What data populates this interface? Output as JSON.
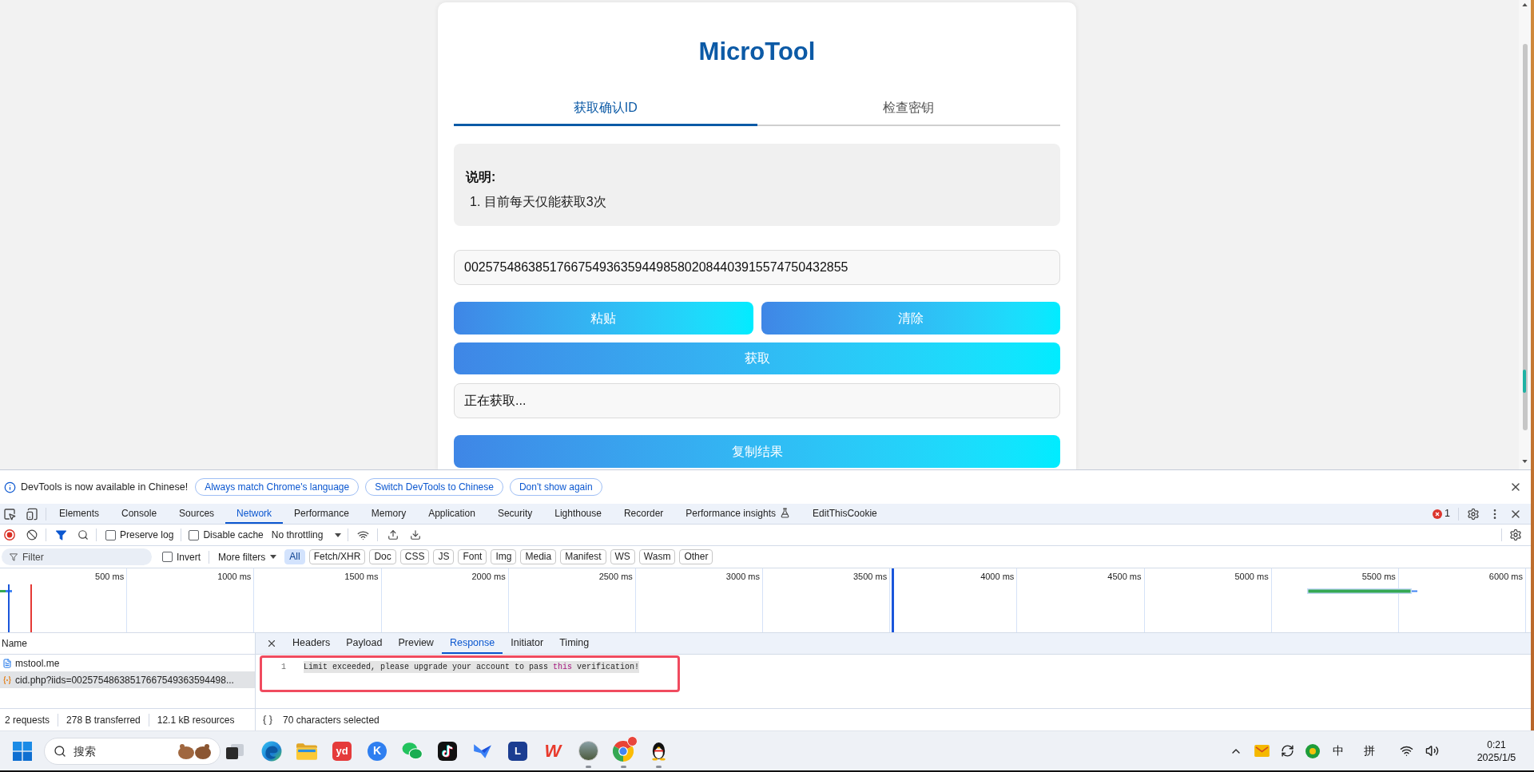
{
  "page": {
    "title": "MicroTool",
    "tabs": [
      {
        "label": "获取确认ID",
        "selected": true
      },
      {
        "label": "检查密钥",
        "selected": false
      }
    ],
    "notice": {
      "heading": "说明:",
      "items": [
        "1. 目前每天仅能获取3次"
      ]
    },
    "id_input": {
      "value": "002575486385176675493635944985802084403915574750432855"
    },
    "button_row": [
      {
        "label": "粘贴"
      },
      {
        "label": "清除"
      }
    ],
    "fetch_button": {
      "label": "获取"
    },
    "result": {
      "value": "正在获取..."
    },
    "copy_button": {
      "label": "复制结果"
    }
  },
  "devtools": {
    "infobar": {
      "message": "DevTools is now available in Chinese!",
      "buttons": [
        "Always match Chrome's language",
        "Switch DevTools to Chinese",
        "Don't show again"
      ]
    },
    "tabs": [
      {
        "label": "Elements",
        "selected": false,
        "experimental": false
      },
      {
        "label": "Console",
        "selected": false,
        "experimental": false
      },
      {
        "label": "Sources",
        "selected": false,
        "experimental": false
      },
      {
        "label": "Network",
        "selected": true,
        "experimental": false
      },
      {
        "label": "Performance",
        "selected": false,
        "experimental": false
      },
      {
        "label": "Memory",
        "selected": false,
        "experimental": false
      },
      {
        "label": "Application",
        "selected": false,
        "experimental": false
      },
      {
        "label": "Security",
        "selected": false,
        "experimental": false
      },
      {
        "label": "Lighthouse",
        "selected": false,
        "experimental": false
      },
      {
        "label": "Recorder",
        "selected": false,
        "experimental": false
      },
      {
        "label": "Performance insights",
        "selected": false,
        "experimental": true
      },
      {
        "label": "EditThisCookie",
        "selected": false,
        "experimental": false
      }
    ],
    "error_count": "1",
    "toolbar": {
      "recording": true,
      "preserve_log": {
        "label": "Preserve log",
        "checked": false
      },
      "disable_cache": {
        "label": "Disable cache",
        "checked": false
      },
      "throttling": "No throttling"
    },
    "filter": {
      "placeholder": "Filter",
      "invert": {
        "label": "Invert",
        "checked": false
      },
      "more_filters": "More filters",
      "types": [
        {
          "label": "All",
          "selected": true
        },
        {
          "label": "Fetch/XHR",
          "selected": false
        },
        {
          "label": "Doc",
          "selected": false
        },
        {
          "label": "CSS",
          "selected": false
        },
        {
          "label": "JS",
          "selected": false
        },
        {
          "label": "Font",
          "selected": false
        },
        {
          "label": "Img",
          "selected": false
        },
        {
          "label": "Media",
          "selected": false
        },
        {
          "label": "Manifest",
          "selected": false
        },
        {
          "label": "WS",
          "selected": false
        },
        {
          "label": "Wasm",
          "selected": false
        },
        {
          "label": "Other",
          "selected": false
        }
      ]
    },
    "timeline": {
      "ticks": [
        "500 ms",
        "1000 ms",
        "1500 ms",
        "2000 ms",
        "2500 ms",
        "3000 ms",
        "3500 ms",
        "4000 ms",
        "4500 ms",
        "5000 ms",
        "5500 ms",
        "6000 ms"
      ]
    },
    "requests": {
      "column": "Name",
      "rows": [
        {
          "name": "mstool.me",
          "kind": "document",
          "selected": false
        },
        {
          "name": "cid.php?iids=00257548638517667549363594498...",
          "kind": "fetch",
          "selected": true
        }
      ]
    },
    "detail": {
      "tabs": [
        {
          "label": "Headers",
          "selected": false
        },
        {
          "label": "Payload",
          "selected": false
        },
        {
          "label": "Preview",
          "selected": false
        },
        {
          "label": "Response",
          "selected": true
        },
        {
          "label": "Initiator",
          "selected": false
        },
        {
          "label": "Timing",
          "selected": false
        }
      ],
      "lines": [
        {
          "number": "1",
          "selected": true,
          "tokens": [
            {
              "text": "Limit exceeded, please upgrade your account to pass ",
              "kind": "plain"
            },
            {
              "text": "this",
              "kind": "keyword"
            },
            {
              "text": " verification!",
              "kind": "plain"
            }
          ]
        }
      ]
    },
    "status": {
      "summary": [
        "2 requests",
        "278 B transferred",
        "12.1 kB resources"
      ],
      "selection": "70 characters selected"
    }
  },
  "taskbar": {
    "search": {
      "placeholder": "搜索"
    },
    "apps": [
      {
        "kind": "taskview",
        "running": false,
        "badge": false
      },
      {
        "kind": "swirl",
        "running": false,
        "badge": false
      },
      {
        "kind": "folder",
        "running": false,
        "badge": false
      },
      {
        "kind": "tile",
        "label": "yd",
        "color": "#e53b3b",
        "running": false,
        "badge": false
      },
      {
        "kind": "disc",
        "label": "K",
        "color": "#2f7ff0",
        "running": false,
        "badge": false
      },
      {
        "kind": "chat",
        "running": false,
        "badge": false
      },
      {
        "kind": "note",
        "running": false,
        "badge": false
      },
      {
        "kind": "bird",
        "running": false,
        "badge": false
      },
      {
        "kind": "tile",
        "label": "L",
        "color": "#1b3d91",
        "running": false,
        "badge": false
      },
      {
        "kind": "glyph",
        "label": "W",
        "color": "#e83a2c",
        "running": false,
        "badge": false
      },
      {
        "kind": "photo",
        "running": true,
        "badge": false
      },
      {
        "kind": "wheel",
        "running": true,
        "badge": true
      },
      {
        "kind": "penguin",
        "running": true,
        "badge": false
      }
    ],
    "tray": {
      "input_mode": "中",
      "ime": "拼",
      "time": "0:21",
      "date": "2025/1/5"
    }
  }
}
